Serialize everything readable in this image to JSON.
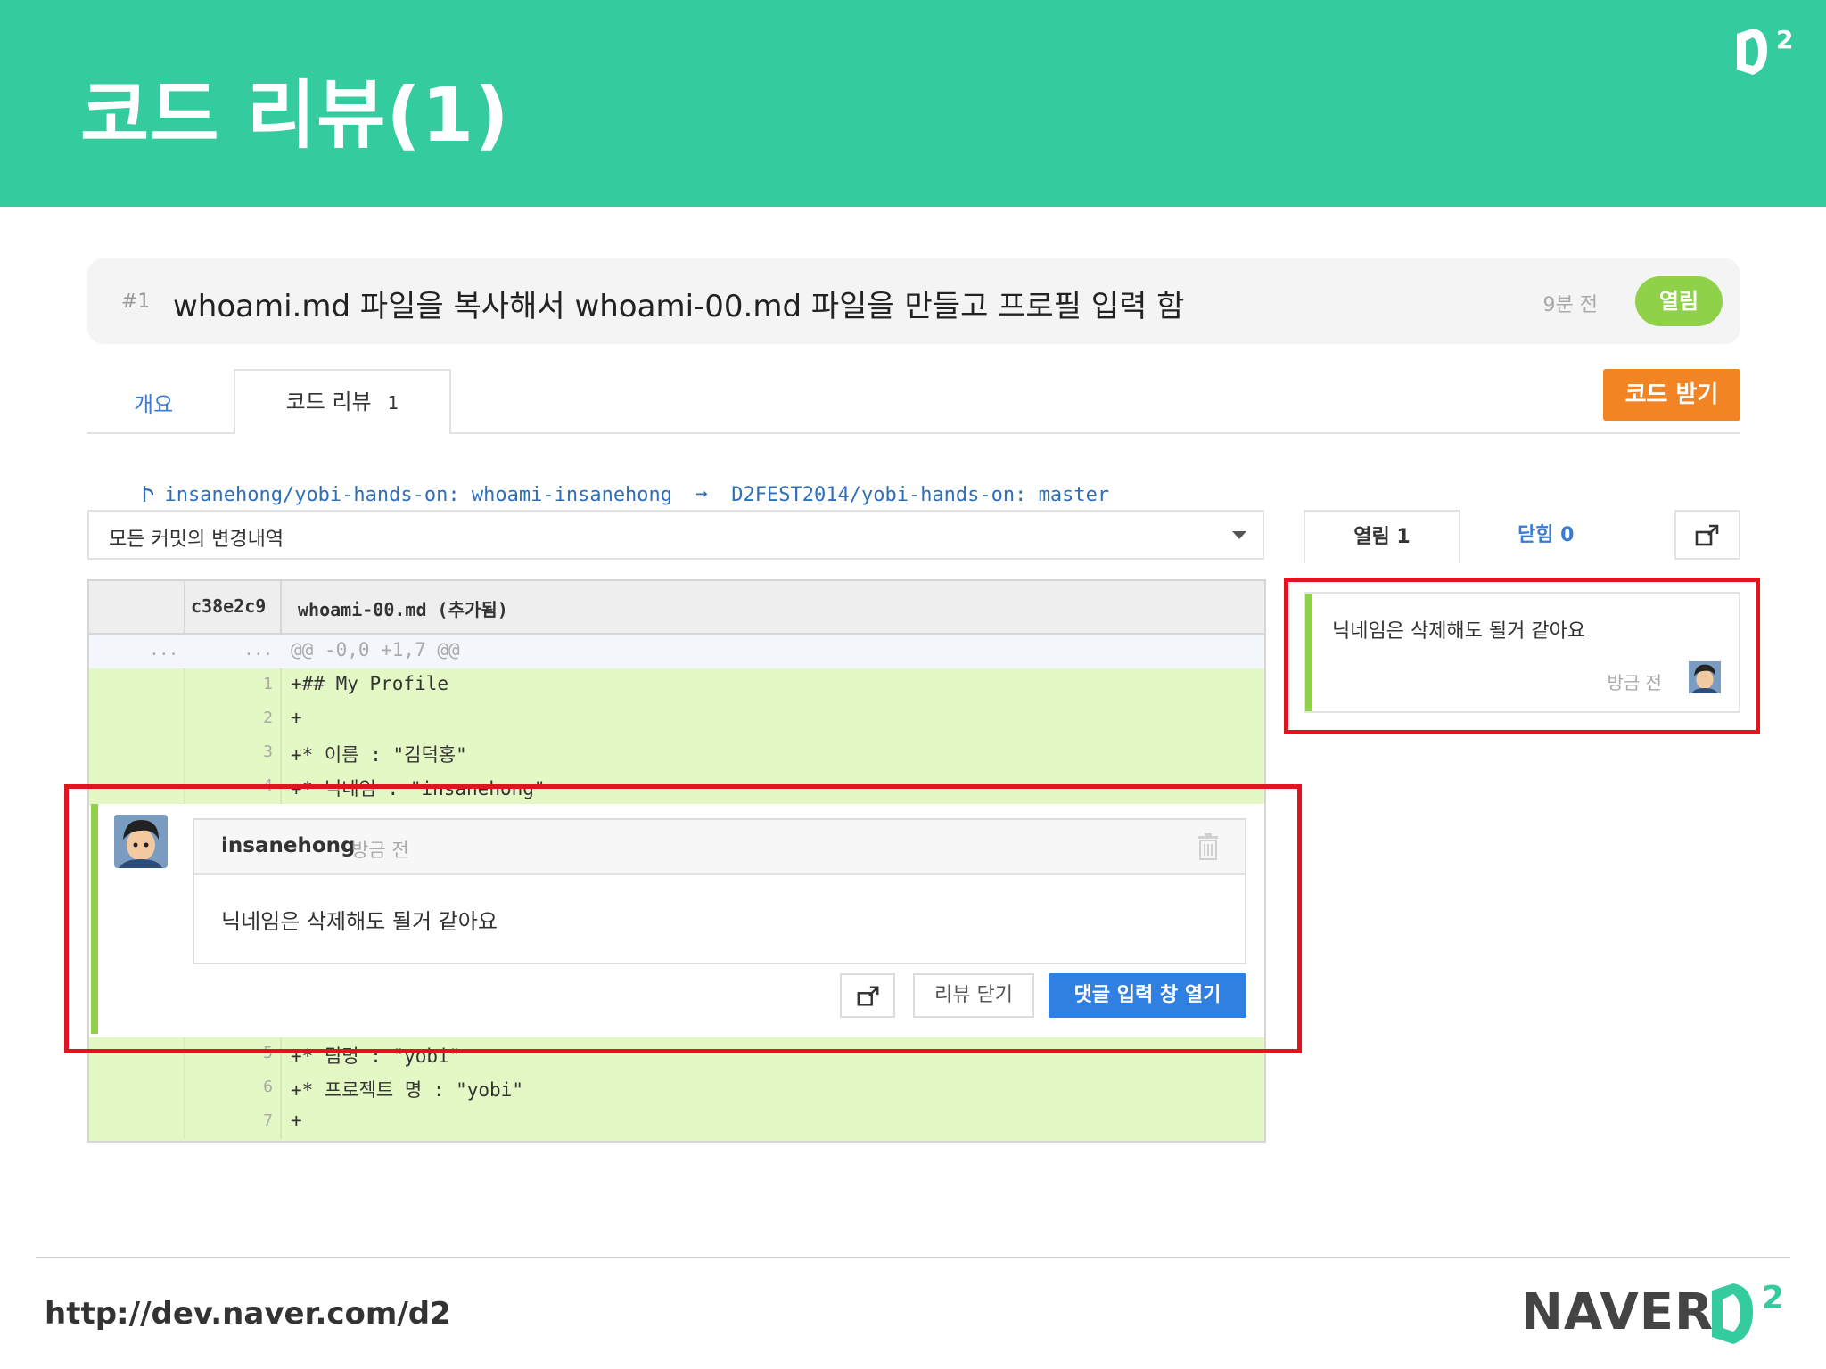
{
  "slide": {
    "title": "코드 리뷰(1)",
    "brand_color": "#34cc9e"
  },
  "pr": {
    "number": "#1",
    "title": "whoami.md 파일을 복사해서 whoami-00.md 파일을 만들고 프로필 입력 함",
    "time": "9분 전",
    "status": "열림"
  },
  "tabs": {
    "overview": "개요",
    "code_review": "코드 리뷰",
    "code_review_count": "1",
    "get_code_button": "코드 받기"
  },
  "branch": {
    "text": "insanehong/yobi-hands-on: whoami-insanehong  ➞  D2FEST2014/yobi-hands-on: master"
  },
  "filter": {
    "selected": "모든 커밋의 변경내역"
  },
  "review_tabs": {
    "open": "열림 1",
    "closed": "닫힘 0"
  },
  "diff": {
    "commit": "c38e2c9",
    "file": "whoami-00.md (추가됨)",
    "hunk": {
      "ln1": "...",
      "ln2": "...",
      "code": "@@ -0,0 +1,7 @@"
    },
    "lines_top": [
      {
        "ln": "1",
        "code": "+## My Profile"
      },
      {
        "ln": "2",
        "code": "+"
      },
      {
        "ln": "3",
        "code": "+* 이름 : \"김덕홍\""
      },
      {
        "ln": "4",
        "code": "+* 닉네임 : \"insanehong\""
      }
    ],
    "lines_bottom": [
      {
        "ln": "5",
        "code": "+* 팀명 : \"yobi\""
      },
      {
        "ln": "6",
        "code": "+* 프로젝트 명 : \"yobi\""
      },
      {
        "ln": "7",
        "code": "+"
      }
    ]
  },
  "comment": {
    "user": "insanehong",
    "time": "방금 전",
    "body": "닉네임은 삭제해도 될거 같아요",
    "close_button": "리뷰 닫기",
    "open_input_button": "댓글 입력 창 열기"
  },
  "review_card": {
    "text": "닉네임은 삭제해도 될거 같아요",
    "time": "방금 전"
  },
  "footer": {
    "url": "http://dev.naver.com/d2",
    "brand": "NAVER"
  }
}
